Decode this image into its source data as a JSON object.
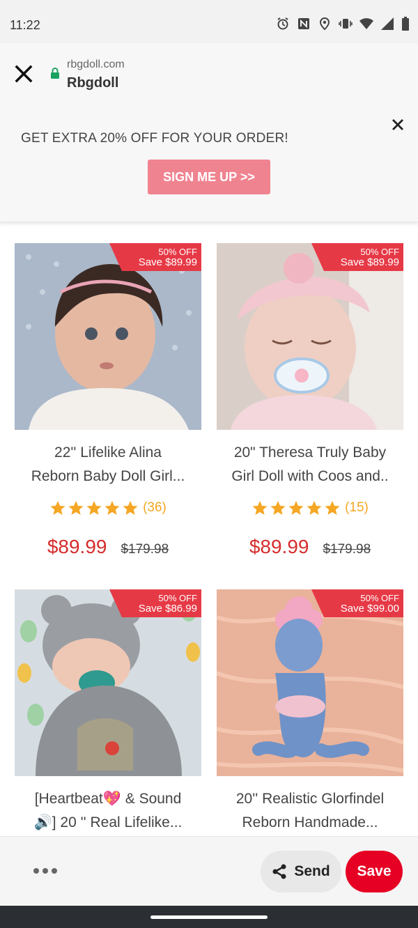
{
  "status_bar": {
    "time": "11:22",
    "icons": [
      "alarm-icon",
      "nfc-icon",
      "location-icon",
      "vibrate-icon",
      "wifi-icon",
      "signal-icon",
      "battery-icon"
    ]
  },
  "browser": {
    "domain": "rbgdoll.com",
    "title": "Rbgdoll",
    "lock_color": "#1aa260"
  },
  "promo": {
    "text": "GET EXTRA 20% OFF FOR YOUR ORDER!",
    "button_label": "SIGN ME UP >>",
    "button_color": "#f08390"
  },
  "products": [
    {
      "badge_off": "50% OFF",
      "badge_save": "Save $89.99",
      "title_line1": "22'' Lifelike Alina",
      "title_line2": "Reborn Baby Doll Girl...",
      "rating": 5,
      "reviews": "(36)",
      "price": "$89.99",
      "old_price": "$179.98"
    },
    {
      "badge_off": "50% OFF",
      "badge_save": "Save $89.99",
      "title_line1": "20\" Theresa Truly Baby",
      "title_line2": "Girl Doll with Coos and..",
      "rating": 5,
      "reviews": "(15)",
      "price": "$89.99",
      "old_price": "$179.98"
    },
    {
      "badge_off": "50% OFF",
      "badge_save": "Save $86.99",
      "title_line1": "[Heartbeat💖 & Sound",
      "title_line2": "🔊] 20 '' Real Lifelike...",
      "price": "",
      "old_price": ""
    },
    {
      "badge_off": "50% OFF",
      "badge_save": "Save $99.00",
      "title_line1": "20'' Realistic Glorfindel",
      "title_line2": "Reborn Handmade...",
      "price": "",
      "old_price": ""
    }
  ],
  "bottom_bar": {
    "more_label": "",
    "send_label": "Send",
    "save_label": "Save",
    "save_color": "#e60023"
  },
  "colors": {
    "badge": "#e63946",
    "price": "#d62c2c",
    "star": "#f5a623"
  }
}
